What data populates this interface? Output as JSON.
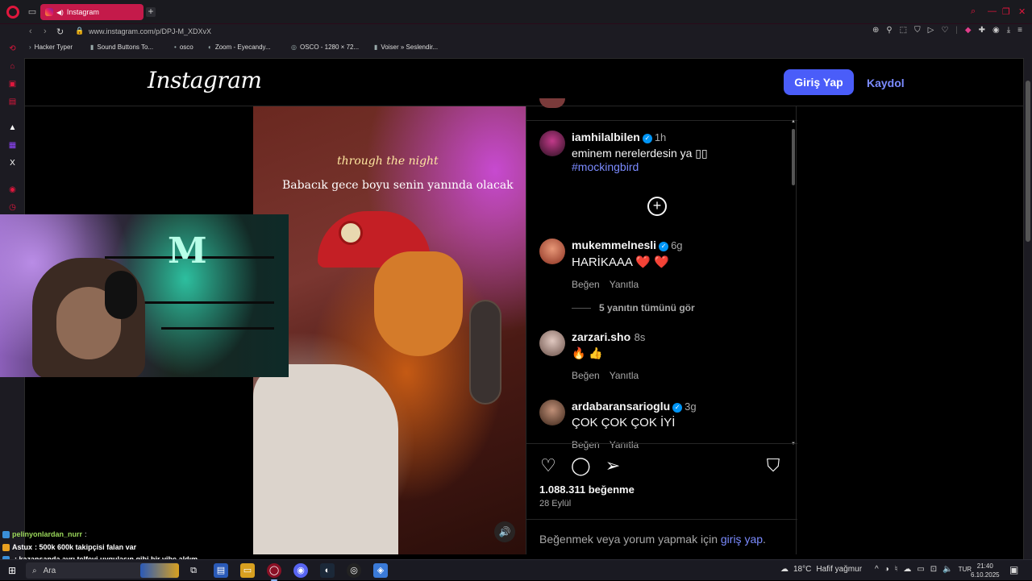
{
  "browser": {
    "tab_title": "Instagram",
    "new_tab": "+",
    "url": "www.instagram.com/p/DPJ-M_XDXvX",
    "bookmarks": [
      {
        "label": "Hacker Typer",
        "icon": "chevron-icon"
      },
      {
        "label": "Sound Buttons To...",
        "icon": "bars-icon"
      },
      {
        "label": "osco",
        "icon": "dot-icon"
      },
      {
        "label": "Zoom - Eyecandy...",
        "icon": "globe-icon"
      },
      {
        "label": "OSCO - 1280 × 72...",
        "icon": "globe-icon"
      },
      {
        "label": "Voiser » Seslendir...",
        "icon": "bars-icon"
      }
    ],
    "accent_color": "#e0173d"
  },
  "instagram": {
    "logo": "Instagram",
    "login_button": "Giriş Yap",
    "signup_link": "Kaydol",
    "login_color": "#4a5df9"
  },
  "video": {
    "caption_line1": "through the night",
    "caption_line2": "Babacık gece boyu senin yanında olacak",
    "mute_icon": "volume-icon"
  },
  "post": {
    "author_comment": {
      "username": "iamhilalbilen",
      "time": "1h",
      "text": "eminem nerelerdesin ya ▯▯",
      "hashtag": "#mockingbird"
    },
    "comments": [
      {
        "username": "mukemmelnesli",
        "verified": true,
        "time": "6g",
        "text": "HARİKAAA ❤️ ❤️",
        "like": "Beğen",
        "reply": "Yanıtla"
      },
      {
        "username": "zarzari.sho",
        "verified": false,
        "time": "8s",
        "text": "🔥 👍",
        "like": "Beğen",
        "reply": "Yanıtla"
      },
      {
        "username": "ardabaransarioglu",
        "verified": true,
        "time": "3g",
        "text": "ÇOK ÇOK ÇOK İYİ",
        "like": "Beğen",
        "reply": "Yanıtla"
      }
    ],
    "view_replies": "5 yanıtın tümünü gör",
    "likes": "1.088.311 beğenme",
    "date": "28 Eylül",
    "login_hint": "Beğenmek veya yorum yapmak için",
    "login_hint_link": "giriş yap",
    "login_hint_end": "."
  },
  "chat": [
    {
      "user": "pelinyonlardan_nurr",
      "text": " :",
      "user_color": "#9bd85a"
    },
    {
      "user": "Astux",
      "text": ": 500k 600k takipçisi falan var",
      "user_color": "#ffffff"
    },
    {
      "user": "",
      "text": ": kazansanda ayrı telfeyi uygulasın gibi bir vibe aldım",
      "user_color": "#9bd85a"
    }
  ],
  "taskbar": {
    "search_placeholder": "Ara",
    "temperature": "18°C",
    "weather": "Hafif yağmur",
    "lang": "TUR",
    "time": "21:40",
    "date": "6.10.2025"
  }
}
